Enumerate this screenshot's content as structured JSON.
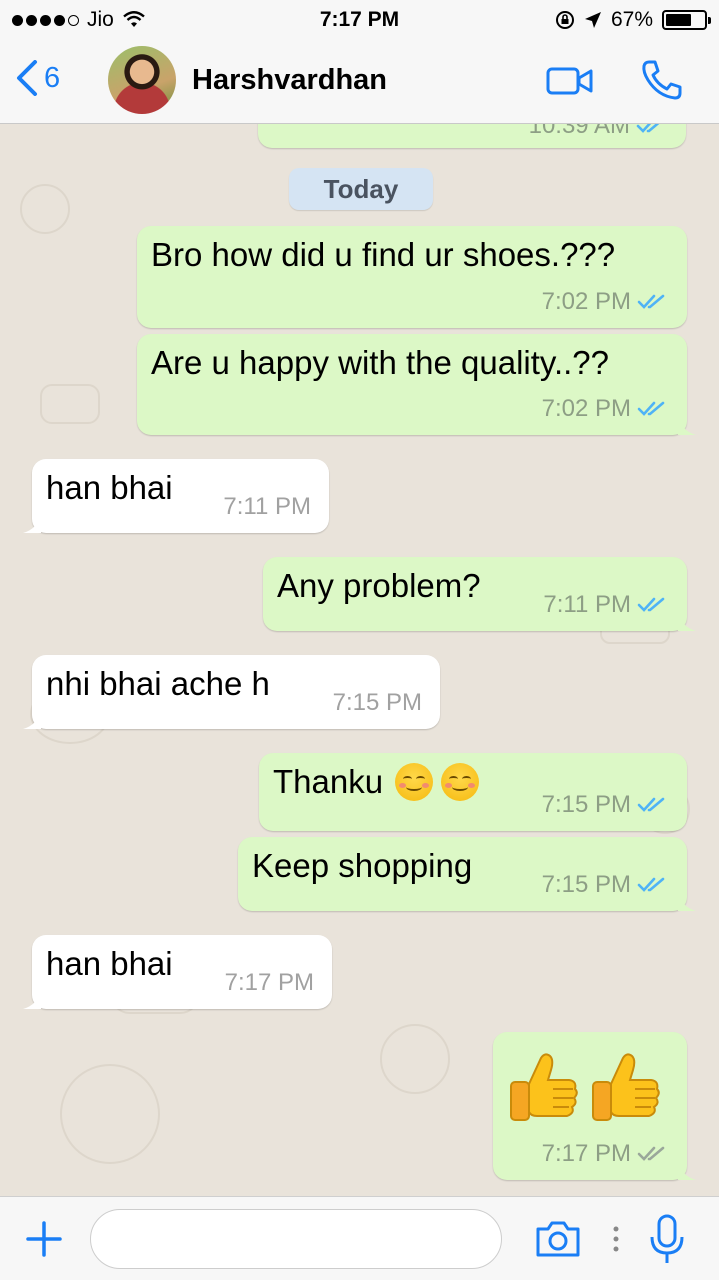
{
  "status_bar": {
    "carrier": "Jio",
    "time": "7:17 PM",
    "battery": "67%",
    "battery_level": 0.67,
    "signal_bars": 4
  },
  "nav": {
    "back_count": "6",
    "contact_name": "Harshvardhan",
    "icons": [
      "back-chevron-icon",
      "video-call-icon",
      "phone-call-icon"
    ]
  },
  "chat": {
    "previous_time": "10:39 AM",
    "date_label": "Today",
    "messages": [
      {
        "dir": "out",
        "text": "Bro how did u find ur shoes.???",
        "time": "7:02 PM",
        "status": "read"
      },
      {
        "dir": "out",
        "text": "Are u happy with the quality..??",
        "time": "7:02 PM",
        "status": "read"
      },
      {
        "dir": "in",
        "text": "han bhai",
        "time": "7:11 PM"
      },
      {
        "dir": "out",
        "text": "Any problem?",
        "time": "7:11 PM",
        "status": "read"
      },
      {
        "dir": "in",
        "text": "nhi bhai ache h",
        "time": "7:15 PM"
      },
      {
        "dir": "out",
        "text": "Thanku",
        "emoji": "smiling-face-emoji x2",
        "time": "7:15 PM",
        "status": "read"
      },
      {
        "dir": "out",
        "text": "Keep shopping",
        "time": "7:15 PM",
        "status": "read"
      },
      {
        "dir": "in",
        "text": "han bhai",
        "time": "7:17 PM"
      },
      {
        "dir": "out",
        "emoji": "thumbs-up-emoji x2",
        "time": "7:17 PM",
        "status": "delivered"
      }
    ]
  },
  "colors": {
    "accent": "#1a7ef5",
    "outgoing_bubble": "#dcf8c6",
    "incoming_bubble": "#ffffff",
    "read_ticks": "#4fb3f6",
    "delivered_ticks": "#9aa79a",
    "chat_background": "#e9e3da"
  },
  "input_bar": {
    "placeholder": "",
    "icons": [
      "plus-icon",
      "camera-icon",
      "microphone-icon"
    ]
  }
}
